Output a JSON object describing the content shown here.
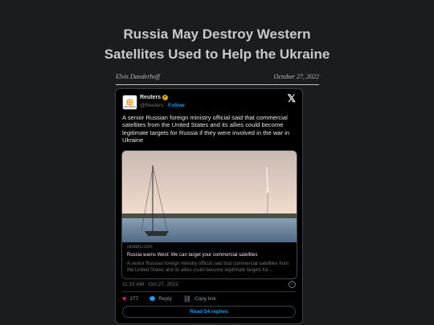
{
  "article": {
    "title_line1": "Russia May Destroy Western",
    "title_line2": "Satellites Used to Help the Ukraine",
    "author": "Elvis Danderhoff",
    "date": "October 27, 2022"
  },
  "tweet": {
    "logo_text": "REUTERS",
    "name": "Reuters",
    "handle": "@Reuters",
    "follow_label": "Follow",
    "text": "A senior Russian foreign ministry official said that commercial satellites from the United States and its allies could become legitimate targets for Russia if they were involved in the war in Ukraine",
    "link": {
      "domain": "reuters.com",
      "title": "Russia warns West: We can target your commercial satellites",
      "description": "A senior Russian foreign ministry official said that commercial satellites from the United States and its allies could become legitimate targets for…"
    },
    "timestamp": "11:15 AM · Oct 27, 2022",
    "likes": "277",
    "reply_label": "Reply",
    "copy_link_label": "Copy link",
    "read_replies_label": "Read 54 replies"
  },
  "colors": {
    "background": "#1b1c1e",
    "link_blue": "#1d9bf0",
    "heart": "#f91880"
  }
}
